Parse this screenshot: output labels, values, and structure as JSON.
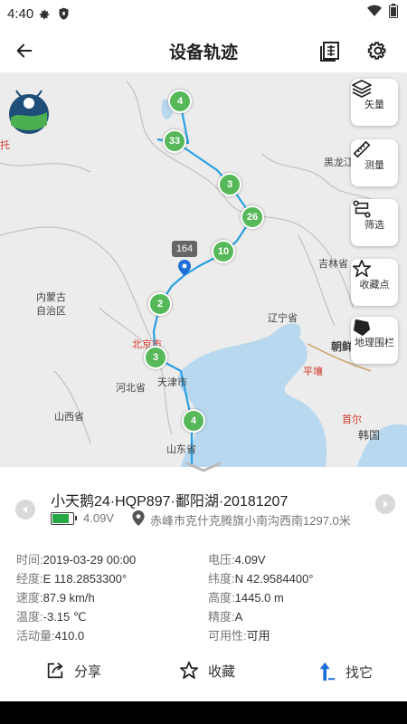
{
  "status_bar": {
    "time": "4:40"
  },
  "header": {
    "title": "设备轨迹"
  },
  "map": {
    "tools": [
      {
        "label": "矢量",
        "icon": "layers-icon"
      },
      {
        "label": "测量",
        "icon": "ruler-icon"
      },
      {
        "label": "筛选",
        "icon": "filter-route-icon"
      },
      {
        "label": "收藏点",
        "icon": "star-icon"
      },
      {
        "label": "地理围栏",
        "icon": "geofence-icon"
      }
    ],
    "place_labels": {
      "heilongjiang": "黑龙江",
      "jilin": "吉林省",
      "neimenggu": "内蒙古\n自治区",
      "liaoning": "辽宁省",
      "beijing": "北京市",
      "tianjin": "天津市",
      "hebei": "河北省",
      "shanxi": "山西省",
      "shandong": "山东省",
      "chaoxian": "朝鲜",
      "pingrang": "平壤",
      "shouer": "首尔",
      "hanguo": "韩国",
      "tuo": "托"
    },
    "clusters": [
      "4",
      "33",
      "3",
      "26",
      "10",
      "2",
      "3",
      "4"
    ],
    "callout": "164"
  },
  "device": {
    "name": "小天鹅24·HQP897·鄱阳湖·20181207",
    "voltage": "4.09V",
    "battery_level": 0.85,
    "location": "赤峰市克什克腾旗小南沟西南1297.0米"
  },
  "details": {
    "time_label": "时间:",
    "time": "2019-03-29 00:00",
    "voltage_label": "电压:",
    "voltage": "4.09V",
    "lng_label": "经度:",
    "lng": "E 118.2853300°",
    "lat_label": "纬度:",
    "lat": "N 42.9584400°",
    "speed_label": "速度:",
    "speed": "87.9 km/h",
    "altitude_label": "高度:",
    "altitude": "1445.0 m",
    "temp_label": "温度:",
    "temp": "-3.15 ℃",
    "accuracy_label": "精度:",
    "accuracy": "A",
    "activity_label": "活动量:",
    "activity": "410.0",
    "availability_label": "可用性:",
    "availability": "可用"
  },
  "actions": {
    "share": "分享",
    "favorite": "收藏",
    "find": "找它"
  },
  "colors": {
    "route": "#2aa0e0",
    "cluster": "#56b858",
    "battery": "#28a745"
  }
}
